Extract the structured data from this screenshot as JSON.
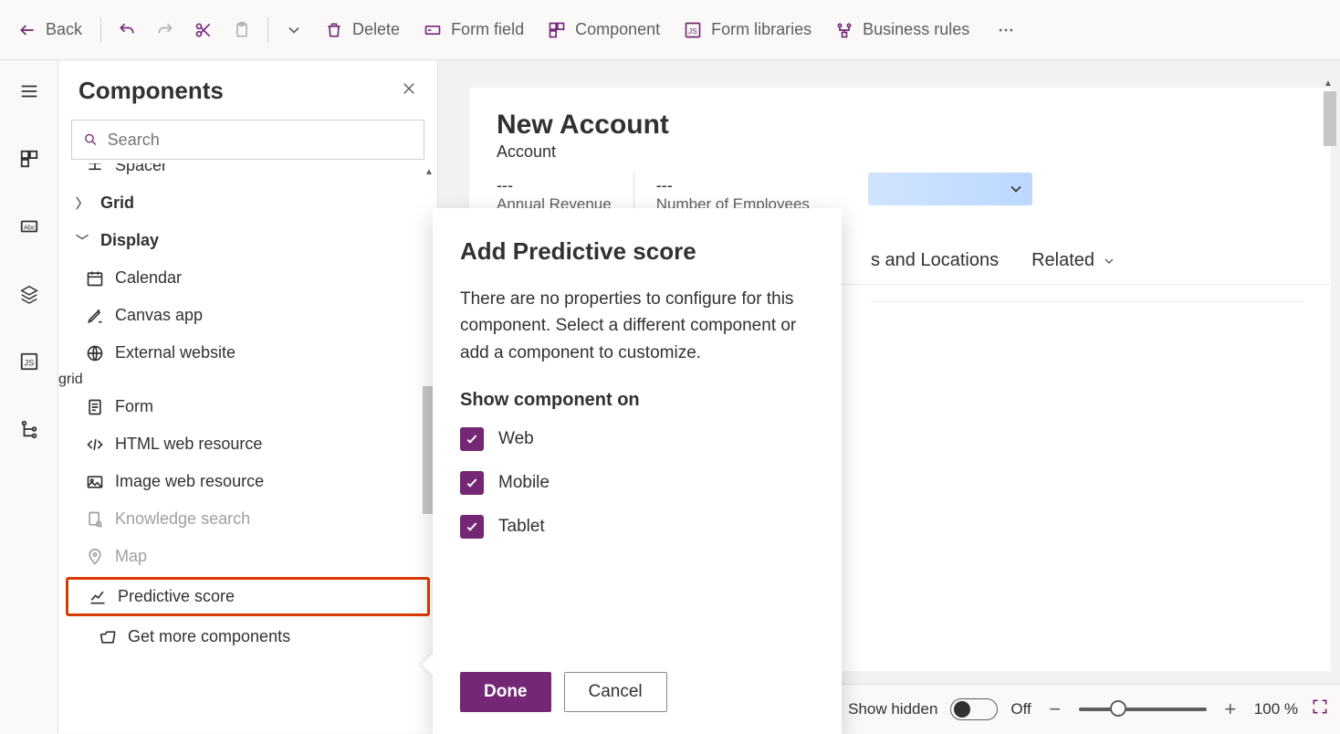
{
  "toolbar": {
    "back": "Back",
    "delete": "Delete",
    "form_field": "Form field",
    "component": "Component",
    "form_libraries": "Form libraries",
    "business_rules": "Business rules"
  },
  "panel": {
    "title": "Components",
    "search_placeholder": "Search",
    "tree": {
      "spacer": "Spacer",
      "grid": "Grid",
      "display": "Display",
      "calendar": "Calendar",
      "canvas_app": "Canvas app",
      "external_website": "External website",
      "form": "Form",
      "html_web_resource": "HTML web resource",
      "image_web_resource": "Image web resource",
      "knowledge_search": "Knowledge search",
      "map": "Map",
      "predictive_score": "Predictive score",
      "get_more": "Get more components"
    }
  },
  "form": {
    "title": "New Account",
    "entity": "Account",
    "fields": {
      "annual_revenue_value": "---",
      "annual_revenue_label": "Annual Revenue",
      "employees_value": "---",
      "employees_label": "Number of Employees"
    },
    "tabs": {
      "addresses": "s and Locations",
      "related": "Related"
    }
  },
  "dialog": {
    "title": "Add Predictive score",
    "body": "There are no properties to configure for this component. Select a different component or add a component to customize.",
    "show_on": "Show component on",
    "checks": {
      "web": "Web",
      "mobile": "Mobile",
      "tablet": "Tablet"
    },
    "done": "Done",
    "cancel": "Cancel"
  },
  "footer": {
    "show_hidden": "Show hidden",
    "off": "Off",
    "zoom": "100 %"
  }
}
